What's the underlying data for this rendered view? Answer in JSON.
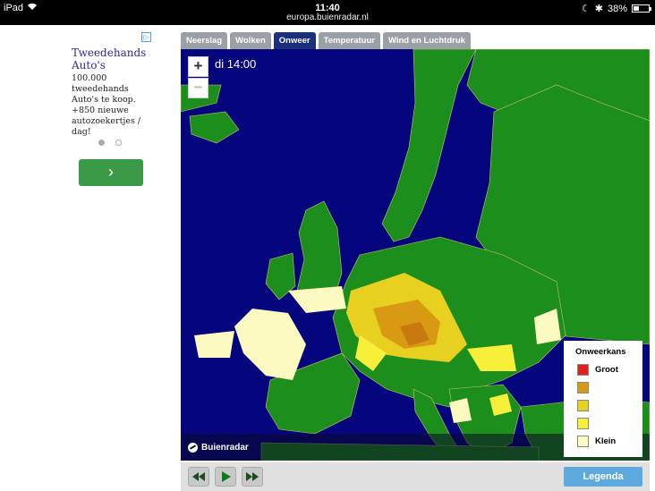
{
  "statusbar": {
    "device": "iPad",
    "time": "11:40",
    "url": "europa.buienradar.nl",
    "battery": "38%",
    "battery_level": 0.38
  },
  "ad": {
    "title": "Tweedehands Auto's",
    "body": "100.000 tweedehands Auto's te koop. +850 nieuwe autozoekertjes / dag!",
    "go_symbol": "›"
  },
  "tabs": [
    {
      "label": "Neerslag",
      "active": false
    },
    {
      "label": "Wolken",
      "active": false
    },
    {
      "label": "Onweer",
      "active": true
    },
    {
      "label": "Temperatuur",
      "active": false
    },
    {
      "label": "Wind en Luchtdruk",
      "active": false
    }
  ],
  "map": {
    "time_label": "di 14:00",
    "zoom_in": "+",
    "zoom_out": "−",
    "brand": "Buienradar",
    "colors": {
      "sea": "#05057e",
      "land": "#1b8e1b",
      "land_dark": "#136a13"
    }
  },
  "legend": {
    "title": "Onweerkans",
    "items": [
      {
        "label": "Groot",
        "color": "#e0201a"
      },
      {
        "label": "",
        "color": "#d79a12"
      },
      {
        "label": "",
        "color": "#e8d020"
      },
      {
        "label": "",
        "color": "#f8f038"
      },
      {
        "label": "Klein",
        "color": "#fcfac0"
      }
    ]
  },
  "controls": {
    "legenda_label": "Legenda"
  }
}
